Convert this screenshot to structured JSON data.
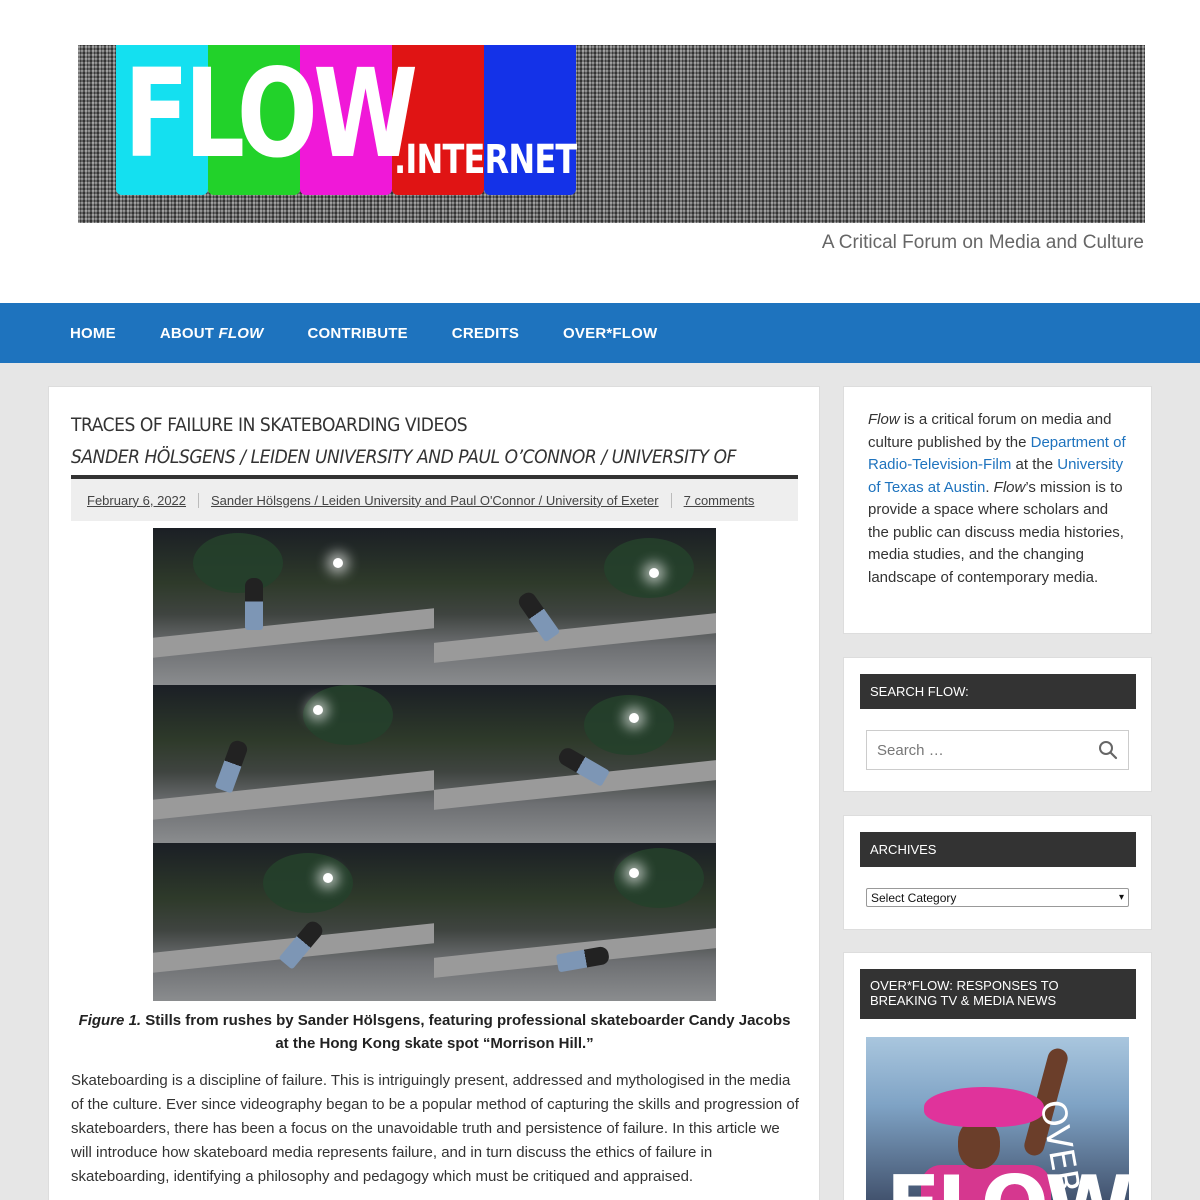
{
  "site": {
    "logo_main": "FLOW",
    "logo_suffix": ".INTERNET",
    "logo_bar_colors": [
      "#14e0f0",
      "#22d22a",
      "#f018d8",
      "#e01414",
      "#1432e8"
    ],
    "tagline": "A Critical Forum on Media and Culture"
  },
  "nav": {
    "items": [
      {
        "label": "HOME"
      },
      {
        "label": "ABOUT ",
        "italic": "FLOW"
      },
      {
        "label": "CONTRIBUTE"
      },
      {
        "label": "CREDITS"
      },
      {
        "label": "OVER*FLOW"
      }
    ],
    "color": "#1e73be"
  },
  "article": {
    "title": "TRACES OF FAILURE IN SKATEBOARDING VIDEOS",
    "byline": "SANDER HÖLSGENS / LEIDEN UNIVERSITY AND PAUL O’CONNOR / UNIVERSITY OF EXETER",
    "meta": {
      "date": "February 6, 2022",
      "authors": "Sander Hölsgens / Leiden University and Paul O'Connor / University of Exeter",
      "comments": "7 comments"
    },
    "figure_label": "Figure 1.",
    "figure_caption": " Stills from rushes by Sander Hölsgens, featuring professional skateboarder Candy Jacobs at the Hong Kong skate spot “Morrison Hill.”",
    "body": "Skateboarding is a discipline of failure. This is intriguingly present, addressed and mythologised in the media of the culture. Ever since videography began to be a popular method of capturing the skills and progression of skateboarders, there has been a focus on the unavoidable truth and persistence of failure. In this article we will introduce how skateboard media represents failure, and in turn discuss the ethics of failure in skateboarding, identifying a philosophy and pedagogy which must be critiqued and appraised."
  },
  "sidebar": {
    "about": {
      "flow": "Flow",
      "t1": " is a critical forum on media and culture published by the ",
      "link1": "Department of Radio-Television-Film",
      "t2": " at the ",
      "link2": "University of Texas at Austin",
      "t3": ". ",
      "flow2": "Flow",
      "t4": "’s mission is to provide a space where scholars and the public can discuss media histories, media studies, and the changing landscape of contemporary media."
    },
    "search": {
      "title": "SEARCH FLOW:",
      "placeholder": "Search …",
      "icon": "search-icon"
    },
    "archives": {
      "title": "ARCHIVES",
      "selected": "Select Category"
    },
    "overflow": {
      "title": "OVER*FLOW: RESPONSES TO BREAKING TV & MEDIA NEWS",
      "image_word": "FLOW",
      "image_side": "OVER"
    }
  }
}
